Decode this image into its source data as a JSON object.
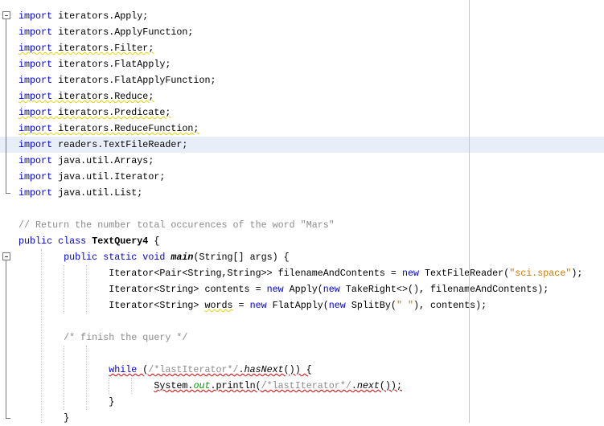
{
  "editor": {
    "highlighted_line": 9,
    "colors": {
      "keyword": "#0000e6",
      "comment": "#8c8c8c",
      "string": "#ce7b00",
      "field": "#009900",
      "current_line": "#e8eef8",
      "margin": "#f0b4b4"
    },
    "lines": [
      [
        {
          "t": "import",
          "c": "kw"
        },
        {
          "t": " iterators.Apply;"
        }
      ],
      [
        {
          "t": "import",
          "c": "kw"
        },
        {
          "t": " iterators.ApplyFunction;"
        }
      ],
      [
        {
          "t": "import",
          "c": "kw warn"
        },
        {
          "t": " iterators.Filter;",
          "c": "warn"
        }
      ],
      [
        {
          "t": "import",
          "c": "kw"
        },
        {
          "t": " iterators.FlatApply;"
        }
      ],
      [
        {
          "t": "import",
          "c": "kw"
        },
        {
          "t": " iterators.FlatApplyFunction;"
        }
      ],
      [
        {
          "t": "import",
          "c": "kw warn"
        },
        {
          "t": " iterators.Reduce;",
          "c": "warn"
        }
      ],
      [
        {
          "t": "import",
          "c": "kw warn"
        },
        {
          "t": " iterators.Predicate;",
          "c": "warn"
        }
      ],
      [
        {
          "t": "import",
          "c": "kw warn"
        },
        {
          "t": " iterators.ReduceFunction;",
          "c": "warn"
        }
      ],
      [
        {
          "t": "import",
          "c": "kw"
        },
        {
          "t": " readers.TextFileReader;"
        }
      ],
      [
        {
          "t": "import",
          "c": "kw"
        },
        {
          "t": " java.util.Arrays;"
        }
      ],
      [
        {
          "t": "import",
          "c": "kw"
        },
        {
          "t": " java.util.Iterator;"
        }
      ],
      [
        {
          "t": "import",
          "c": "kw"
        },
        {
          "t": " java.util.List;"
        }
      ],
      [],
      [
        {
          "t": "// Return the number total occurences of the word \"Mars\"",
          "c": "cm"
        }
      ],
      [
        {
          "t": "public class",
          "c": "kw"
        },
        {
          "t": " "
        },
        {
          "t": "TextQuery4",
          "c": "b"
        },
        {
          "t": " {"
        }
      ],
      [
        {
          "t": "        "
        },
        {
          "t": "public static void",
          "c": "kw"
        },
        {
          "t": " "
        },
        {
          "t": "main",
          "c": "b i"
        },
        {
          "t": "(String[] args) {"
        }
      ],
      [
        {
          "t": "                Iterator<Pair<String,String>> filenameAndContents = "
        },
        {
          "t": "new",
          "c": "kw"
        },
        {
          "t": " TextFileReader("
        },
        {
          "t": "\"sci.space\"",
          "c": "str"
        },
        {
          "t": ");"
        }
      ],
      [
        {
          "t": "                Iterator<String> contents = "
        },
        {
          "t": "new",
          "c": "kw"
        },
        {
          "t": " Apply("
        },
        {
          "t": "new",
          "c": "kw"
        },
        {
          "t": " TakeRight<>(), filenameAndContents);"
        }
      ],
      [
        {
          "t": "                Iterator<String> "
        },
        {
          "t": "words",
          "c": "warn"
        },
        {
          "t": " = "
        },
        {
          "t": "new",
          "c": "kw"
        },
        {
          "t": " FlatApply("
        },
        {
          "t": "new",
          "c": "kw"
        },
        {
          "t": " SplitBy("
        },
        {
          "t": "\" \"",
          "c": "str"
        },
        {
          "t": "), contents);"
        }
      ],
      [],
      [
        {
          "t": "        "
        },
        {
          "t": "/* finish the query */",
          "c": "cm"
        }
      ],
      [],
      [
        {
          "t": "                "
        },
        {
          "t": "while",
          "c": "kw err"
        },
        {
          "t": " (",
          "c": "err"
        },
        {
          "t": "/*lastIterator*/",
          "c": "cm err"
        },
        {
          "t": ".",
          "c": "err"
        },
        {
          "t": "hasNext",
          "c": "i err"
        },
        {
          "t": "()) {",
          "c": "err"
        }
      ],
      [
        {
          "t": "                        "
        },
        {
          "t": "System.",
          "c": "err"
        },
        {
          "t": "out",
          "c": "fld err"
        },
        {
          "t": ".println(",
          "c": "err"
        },
        {
          "t": "/*lastIterator*/",
          "c": "cm err"
        },
        {
          "t": ".",
          "c": "err"
        },
        {
          "t": "next",
          "c": "i err"
        },
        {
          "t": "());",
          "c": "err"
        }
      ],
      [
        {
          "t": "                }"
        }
      ],
      [
        {
          "t": "        }"
        }
      ]
    ]
  }
}
